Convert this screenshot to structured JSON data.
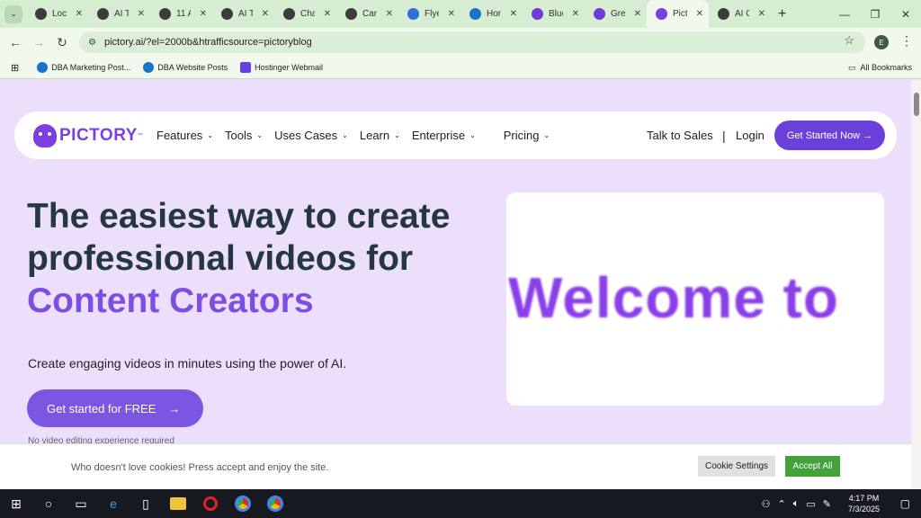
{
  "browser": {
    "tabs": [
      {
        "title": "Loca",
        "favicon": "#3c3c3c"
      },
      {
        "title": "AI To",
        "favicon": "#3c3c3c"
      },
      {
        "title": "11 A",
        "favicon": "#3c3c3c"
      },
      {
        "title": "AI To",
        "favicon": "#3c3c3c"
      },
      {
        "title": "Cha",
        "favicon": "#3c3c3c"
      },
      {
        "title": "Can",
        "favicon": "#3c3c3c"
      },
      {
        "title": "Flye",
        "favicon": "#2f6fd6"
      },
      {
        "title": "Hon",
        "favicon": "#1a73c8"
      },
      {
        "title": "Blue",
        "favicon": "#6e3bd6"
      },
      {
        "title": "Gre",
        "favicon": "#6e3bd6"
      },
      {
        "title": "Pict",
        "favicon": "#7d3ee0"
      },
      {
        "title": "AI C",
        "favicon": "#3c3c3c"
      }
    ],
    "url": "pictory.ai/?el=2000b&htrafficsource=pictoryblog",
    "profile_initial": "E",
    "bookmarks": [
      {
        "label": "DBA Marketing Post..."
      },
      {
        "label": "DBA Website Posts"
      },
      {
        "label": "Hostinger Webmail"
      }
    ],
    "all_bookmarks": "All Bookmarks"
  },
  "site": {
    "logo": "PICTORY",
    "logo_tm": "™",
    "nav": [
      "Features",
      "Tools",
      "Uses Cases",
      "Learn",
      "Enterprise",
      "Pricing"
    ],
    "talk_to_sales": "Talk to Sales",
    "separator": "|",
    "login": "Login",
    "cta": "Get Started Now →",
    "hero": {
      "line1": "The easiest way to create",
      "line2": "professional videos for",
      "accent": "Content Creators",
      "subtitle": "Create engaging videos in minutes using the power of AI.",
      "button": "Get started for FREE",
      "button_arrow": "→",
      "note": "No video editing experience required"
    },
    "video_text": "Welcome to",
    "cookie": {
      "message": "Who doesn't love cookies! Press accept and enjoy the site.",
      "settings": "Cookie Settings",
      "accept": "Accept All"
    }
  },
  "taskbar": {
    "time": "4:17 PM",
    "date": "7/3/2025"
  }
}
